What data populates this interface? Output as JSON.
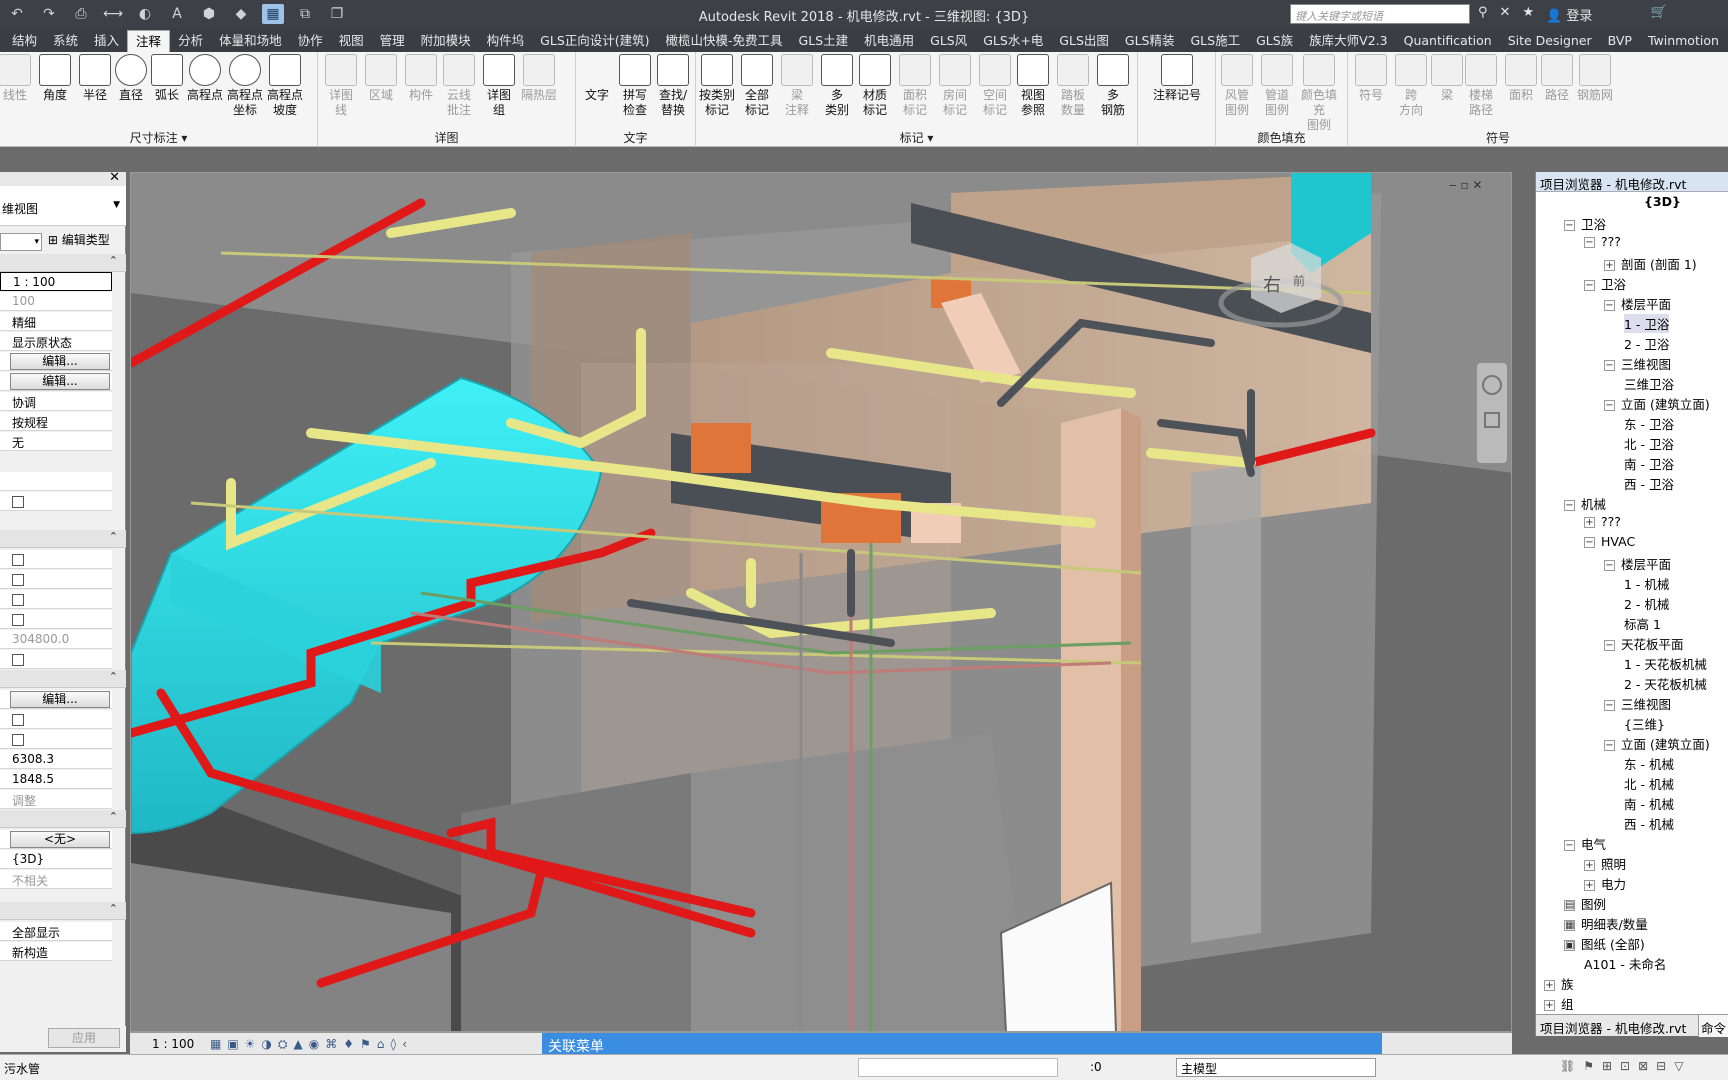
{
  "window": {
    "title": "Autodesk Revit 2018 -    机电修改.rvt - 三维视图: {3D}",
    "search_placeholder": "键入关键字或短语",
    "login": "登录"
  },
  "tabs": [
    "结构",
    "系统",
    "插入",
    "注释",
    "分析",
    "体量和场地",
    "协作",
    "视图",
    "管理",
    "附加模块",
    "构件坞",
    "GLS正向设计(建筑)",
    "橄榄山快模-免费工具",
    "GLS土建",
    "机电通用",
    "GLS风",
    "GLS水+电",
    "GLS出图",
    "GLS精装",
    "GLS施工",
    "GLS族",
    "族库大师V2.3",
    "Quantification",
    "Site Designer",
    "BVP",
    "Twinmotion"
  ],
  "active_tab": "注释",
  "ribbon": {
    "dimension": {
      "label": "尺寸标注",
      "buttons": [
        "线性",
        "角度",
        "半径",
        "直径",
        "弧长",
        "高程点",
        "高程点\n坐标",
        "高程点\n坡度"
      ]
    },
    "detail": {
      "label": "详图",
      "buttons": [
        "详图\n线",
        "区域",
        "构件",
        "云线\n批注",
        "详图\n组",
        "隔热层"
      ]
    },
    "text": {
      "label": "文字",
      "buttons": [
        "文字",
        "拼写\n检查",
        "查找/\n替换"
      ]
    },
    "tag": {
      "label": "标记",
      "buttons": [
        "按类别\n标记",
        "全部\n标记",
        "梁\n注释",
        "多\n类别",
        "材质\n标记",
        "面积\n标记",
        "房间\n标记",
        "空间\n标记",
        "视图\n参照",
        "踏板\n数量",
        "多\n钢筋"
      ]
    },
    "keynote": {
      "buttons": [
        "注释记号"
      ]
    },
    "color_fill": {
      "label": "颜色填充",
      "buttons": [
        "风管\n图例",
        "管道\n图例",
        "颜色填充\n图例"
      ]
    },
    "symbol": {
      "label": "符号",
      "buttons": [
        "符号",
        "跨\n方向",
        "梁",
        "楼梯\n路径",
        "面积",
        "路径",
        "钢筋网"
      ]
    }
  },
  "properties": {
    "view_type": "维视图",
    "edit_type": "编辑类型",
    "rows": [
      {
        "v": "1 : 100",
        "kind": "input"
      },
      {
        "v": "100",
        "kind": "gray"
      },
      {
        "v": "精细",
        "kind": "text"
      },
      {
        "v": "显示原状态",
        "kind": "text"
      },
      {
        "v": "编辑...",
        "kind": "button"
      },
      {
        "v": "编辑...",
        "kind": "button"
      },
      {
        "v": "协调",
        "kind": "text"
      },
      {
        "v": "按规程",
        "kind": "text"
      },
      {
        "v": "无",
        "kind": "text"
      }
    ],
    "rows2": [
      {
        "v": "304800.0",
        "kind": "gray"
      }
    ],
    "rows3": [
      {
        "v": "6308.3",
        "kind": "text"
      },
      {
        "v": "1848.5",
        "kind": "text"
      },
      {
        "v": "调整",
        "kind": "gray"
      }
    ],
    "none_button": "<无>",
    "rows4": [
      {
        "v": "{3D}",
        "kind": "text"
      },
      {
        "v": "不相关",
        "kind": "gray"
      }
    ],
    "rows5": [
      {
        "v": "全部显示",
        "kind": "text"
      },
      {
        "v": "新构造",
        "kind": "text"
      }
    ],
    "edit_button": "编辑...",
    "apply": "应用"
  },
  "browser": {
    "title": "项目浏览器 - 机电修改.rvt",
    "footer_tab": "项目浏览器 - 机电修改.rvt",
    "footer_tab2": "命令",
    "nodes": [
      {
        "t": "{3D}",
        "lvl": 5,
        "tog": "",
        "bold": true
      },
      {
        "t": "卫浴",
        "lvl": 1,
        "tog": "−"
      },
      {
        "t": "???",
        "lvl": 2,
        "tog": "−"
      },
      {
        "t": "剖面 (剖面 1)",
        "lvl": 3,
        "tog": "+"
      },
      {
        "t": "卫浴",
        "lvl": 2,
        "tog": "−"
      },
      {
        "t": "楼层平面",
        "lvl": 3,
        "tog": "−"
      },
      {
        "t": "1 - 卫浴",
        "lvl": 4,
        "tog": "",
        "sel": true
      },
      {
        "t": "2 - 卫浴",
        "lvl": 4,
        "tog": ""
      },
      {
        "t": "三维视图",
        "lvl": 3,
        "tog": "−"
      },
      {
        "t": "三维卫浴",
        "lvl": 4,
        "tog": ""
      },
      {
        "t": "立面 (建筑立面)",
        "lvl": 3,
        "tog": "−"
      },
      {
        "t": "东 - 卫浴",
        "lvl": 4,
        "tog": ""
      },
      {
        "t": "北 - 卫浴",
        "lvl": 4,
        "tog": ""
      },
      {
        "t": "南 - 卫浴",
        "lvl": 4,
        "tog": ""
      },
      {
        "t": "西 - 卫浴",
        "lvl": 4,
        "tog": ""
      },
      {
        "t": "机械",
        "lvl": 1,
        "tog": "−"
      },
      {
        "t": "???",
        "lvl": 2,
        "tog": "+"
      },
      {
        "t": "HVAC",
        "lvl": 2,
        "tog": "−"
      },
      {
        "t": "楼层平面",
        "lvl": 3,
        "tog": "−"
      },
      {
        "t": "1 - 机械",
        "lvl": 4,
        "tog": ""
      },
      {
        "t": "2 - 机械",
        "lvl": 4,
        "tog": ""
      },
      {
        "t": "标高 1",
        "lvl": 4,
        "tog": ""
      },
      {
        "t": "天花板平面",
        "lvl": 3,
        "tog": "−"
      },
      {
        "t": "1 - 天花板机械",
        "lvl": 4,
        "tog": ""
      },
      {
        "t": "2 - 天花板机械",
        "lvl": 4,
        "tog": ""
      },
      {
        "t": "三维视图",
        "lvl": 3,
        "tog": "−"
      },
      {
        "t": "{三维}",
        "lvl": 4,
        "tog": ""
      },
      {
        "t": "立面 (建筑立面)",
        "lvl": 3,
        "tog": "−"
      },
      {
        "t": "东 - 机械",
        "lvl": 4,
        "tog": ""
      },
      {
        "t": "北 - 机械",
        "lvl": 4,
        "tog": ""
      },
      {
        "t": "南 - 机械",
        "lvl": 4,
        "tog": ""
      },
      {
        "t": "西 - 机械",
        "lvl": 4,
        "tog": ""
      },
      {
        "t": "电气",
        "lvl": 1,
        "tog": "−"
      },
      {
        "t": "照明",
        "lvl": 2,
        "tog": "+"
      },
      {
        "t": "电力",
        "lvl": 2,
        "tog": "+"
      },
      {
        "t": "图例",
        "lvl": 1,
        "tog": "▤"
      },
      {
        "t": "明细表/数量",
        "lvl": 1,
        "tog": "▦"
      },
      {
        "t": "图纸 (全部)",
        "lvl": 1,
        "tog": "▣"
      },
      {
        "t": "A101 - 未命名",
        "lvl": 2,
        "tog": ""
      },
      {
        "t": "族",
        "lvl": 0,
        "tog": "+"
      },
      {
        "t": "组",
        "lvl": 0,
        "tog": "+"
      }
    ]
  },
  "viewcube": {
    "front": "右",
    "back": "前"
  },
  "view_bar": {
    "scale": "1 : 100",
    "context_menu": "关联菜单"
  },
  "status": {
    "message": "污水管",
    "zero": ":0",
    "model": "主模型"
  },
  "colors": {
    "cyan": "#2fe0e8",
    "red": "#e01818",
    "pipe_yellow": "#e7e78a",
    "orange": "#e0753a",
    "duct_dark": "#4a4e55",
    "wall": "#c9a98e"
  }
}
